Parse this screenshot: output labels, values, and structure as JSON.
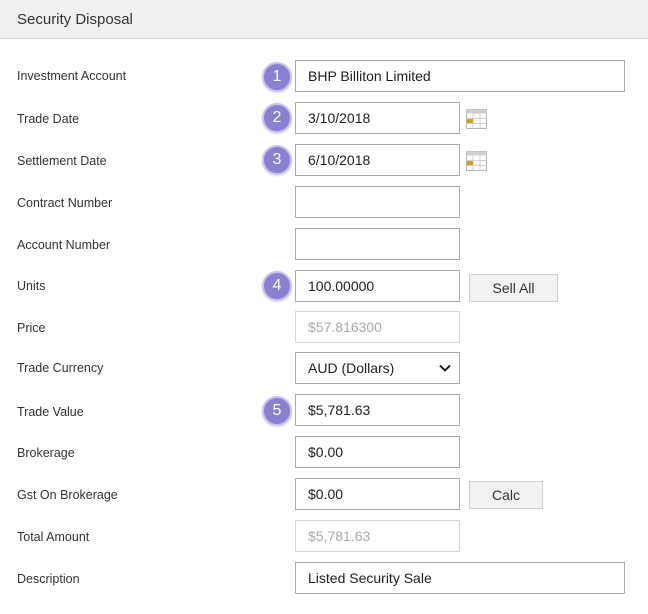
{
  "header": {
    "title": "Security Disposal"
  },
  "fields": {
    "investment_account": {
      "label": "Investment Account",
      "value": "BHP Billiton Limited",
      "step": "1"
    },
    "trade_date": {
      "label": "Trade Date",
      "value": "3/10/2018",
      "step": "2"
    },
    "settlement_date": {
      "label": "Settlement Date",
      "value": "6/10/2018",
      "step": "3"
    },
    "contract_number": {
      "label": "Contract Number",
      "value": ""
    },
    "account_number": {
      "label": "Account Number",
      "value": ""
    },
    "units": {
      "label": "Units",
      "value": "100.00000",
      "step": "4"
    },
    "price": {
      "label": "Price",
      "value": "$57.816300"
    },
    "trade_currency": {
      "label": "Trade Currency",
      "value": "AUD (Dollars)"
    },
    "trade_value": {
      "label": "Trade Value",
      "value": "$5,781.63",
      "step": "5"
    },
    "brokerage": {
      "label": "Brokerage",
      "value": "$0.00"
    },
    "gst_on_brokerage": {
      "label": "Gst On Brokerage",
      "value": "$0.00"
    },
    "total_amount": {
      "label": "Total Amount",
      "value": "$5,781.63"
    },
    "description": {
      "label": "Description",
      "value": "Listed Security Sale"
    }
  },
  "buttons": {
    "sell_all": "Sell All",
    "calc": "Calc"
  },
  "colors": {
    "badge": "#8a80d1",
    "header_bg": "#f0f0f0",
    "calendar_accent": "#d4a017"
  }
}
